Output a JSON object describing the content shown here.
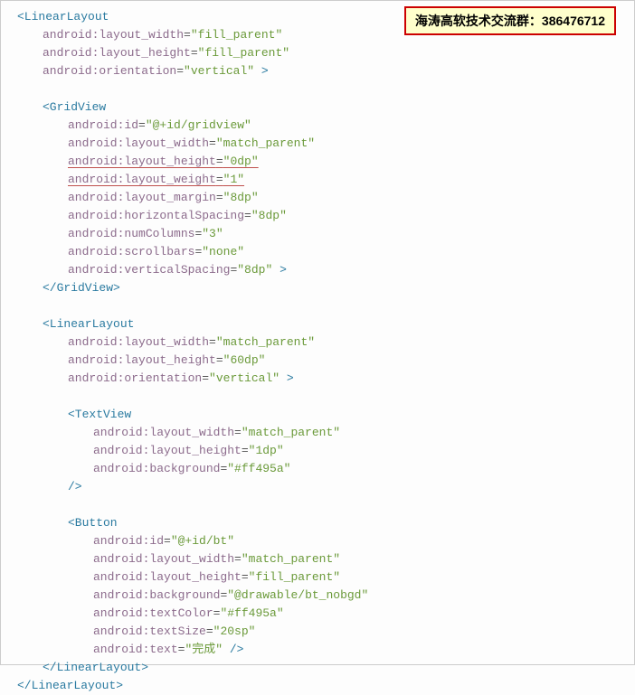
{
  "badge": {
    "text": "海涛高软技术交流群：386476712"
  },
  "xml": {
    "root": {
      "open": "<LinearLayout",
      "attrs": [
        {
          "n": "android:layout_width",
          "v": "\"fill_parent\""
        },
        {
          "n": "android:layout_height",
          "v": "\"fill_parent\""
        },
        {
          "n": "android:orientation",
          "v": "\"vertical\"",
          "tail": " >"
        }
      ],
      "close": "</LinearLayout>"
    },
    "gridview": {
      "open": "<GridView",
      "attrs": [
        {
          "n": "android:id",
          "v": "\"@+id/gridview\""
        },
        {
          "n": "android:layout_width",
          "v": "\"match_parent\""
        },
        {
          "n": "android:layout_height",
          "v": "\"0dp\"",
          "ul": true
        },
        {
          "n": "android:layout_weight",
          "v": "\"1\"",
          "ul": true
        },
        {
          "n": "android:layout_margin",
          "v": "\"8dp\""
        },
        {
          "n": "android:horizontalSpacing",
          "v": "\"8dp\""
        },
        {
          "n": "android:numColumns",
          "v": "\"3\""
        },
        {
          "n": "android:scrollbars",
          "v": "\"none\""
        },
        {
          "n": "android:verticalSpacing",
          "v": "\"8dp\"",
          "tail": " >"
        }
      ],
      "close": "</GridView>"
    },
    "inner_ll": {
      "open": "<LinearLayout",
      "attrs": [
        {
          "n": "android:layout_width",
          "v": "\"match_parent\""
        },
        {
          "n": "android:layout_height",
          "v": "\"60dp\""
        },
        {
          "n": "android:orientation",
          "v": "\"vertical\"",
          "tail": " >"
        }
      ],
      "close": "</LinearLayout>"
    },
    "textview": {
      "open": "<TextView",
      "attrs": [
        {
          "n": "android:layout_width",
          "v": "\"match_parent\""
        },
        {
          "n": "android:layout_height",
          "v": "\"1dp\""
        },
        {
          "n": "android:background",
          "v": "\"#ff495a\""
        }
      ],
      "selfclose": "/>"
    },
    "button": {
      "open": "<Button",
      "attrs": [
        {
          "n": "android:id",
          "v": "\"@+id/bt\""
        },
        {
          "n": "android:layout_width",
          "v": "\"match_parent\""
        },
        {
          "n": "android:layout_height",
          "v": "\"fill_parent\""
        },
        {
          "n": "android:background",
          "v": "\"@drawable/bt_nobgd\""
        },
        {
          "n": "android:textColor",
          "v": "\"#ff495a\""
        },
        {
          "n": "android:textSize",
          "v": "\"20sp\""
        },
        {
          "n": "android:text",
          "v": "\"完成\"",
          "tail": " />"
        }
      ]
    }
  }
}
